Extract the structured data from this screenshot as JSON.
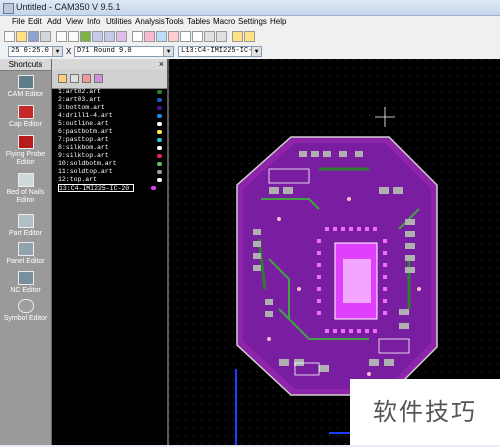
{
  "window": {
    "title": "Untitled - CAM350 V 9.5.1"
  },
  "menu": [
    "File",
    "Edit",
    "Add",
    "View",
    "Info",
    "Utilities",
    "Analysis",
    "Tools",
    "Tables",
    "Macro",
    "Settings",
    "Help"
  ],
  "toolbar2": {
    "grid": "25 0:25.0",
    "layer_x": "X",
    "dcode": "D71   Round 9.0",
    "layer_select": "L13:C4-IMI225-IC-20"
  },
  "shortcuts": {
    "header": "Shortcuts",
    "items": [
      {
        "label": "CAM Editor",
        "icon": "cam-editor-icon"
      },
      {
        "label": "Cap Editor",
        "icon": "cap-editor-icon"
      },
      {
        "label": "Flying Probe Editor",
        "icon": "flying-probe-icon"
      },
      {
        "label": "Bed of Nails Editor",
        "icon": "bed-of-nails-icon"
      },
      {
        "label": "Part Editor",
        "icon": "part-editor-icon"
      },
      {
        "label": "Panel Editor",
        "icon": "panel-editor-icon"
      },
      {
        "label": "NC Editor",
        "icon": "nc-editor-icon"
      },
      {
        "label": "Symbol Editor",
        "icon": "symbol-editor-icon"
      }
    ]
  },
  "layers": [
    {
      "label": "1:art02.art",
      "color": "#2e7d32"
    },
    {
      "label": "2:art03.art",
      "color": "#1565c0"
    },
    {
      "label": "3:bottom.art",
      "color": "#4a148c"
    },
    {
      "label": "4:drill1-4.art",
      "color": "#1e88e5"
    },
    {
      "label": "5:outline.art",
      "color": "#ffffff"
    },
    {
      "label": "6:pastbotm.art",
      "color": "#ffeb3b"
    },
    {
      "label": "7:pasttop.art",
      "color": "#26c6da"
    },
    {
      "label": "8:silkbom.art",
      "color": "#ffffff"
    },
    {
      "label": "9:silktop.art",
      "color": "#e91e63"
    },
    {
      "label": "10:soldbotm.art",
      "color": "#66bb6a"
    },
    {
      "label": "11:soldtop.art",
      "color": "#9e9e9e"
    },
    {
      "label": "12:top.art",
      "color": "#ffffff"
    },
    {
      "label": "13:C4-IMI225-IC-20",
      "color": "#e040fb"
    }
  ],
  "watermark": "软件技巧",
  "colors": {
    "board": "#9c27b0",
    "copper": "#e040fb",
    "silk": "#ffffff",
    "canvas_bg": "#000000"
  }
}
